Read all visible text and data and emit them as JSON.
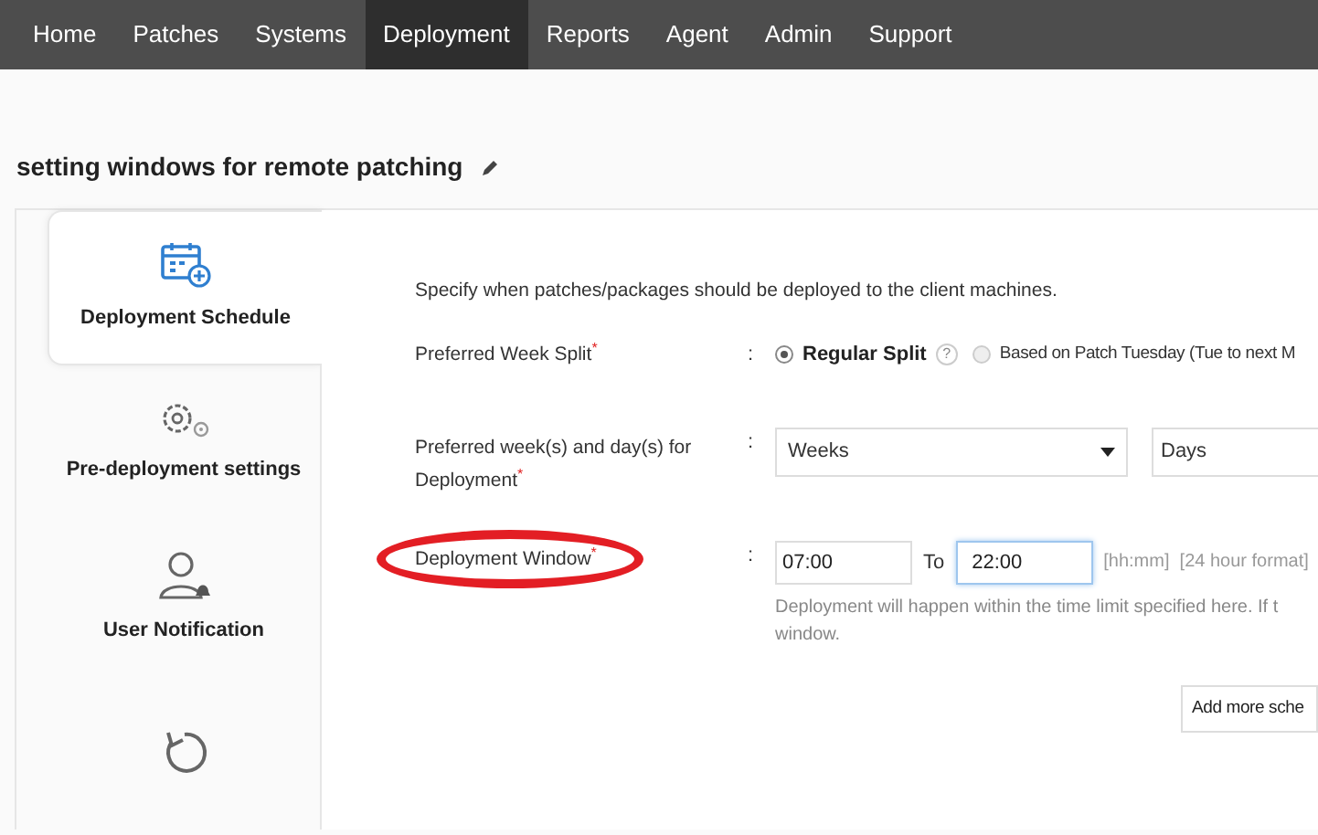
{
  "nav": [
    {
      "label": "Home",
      "selected": false
    },
    {
      "label": "Patches",
      "selected": false
    },
    {
      "label": "Systems",
      "selected": false
    },
    {
      "label": "Deployment",
      "selected": true
    },
    {
      "label": "Reports",
      "selected": false
    },
    {
      "label": "Agent",
      "selected": false
    },
    {
      "label": "Admin",
      "selected": false
    },
    {
      "label": "Support",
      "selected": false
    }
  ],
  "page_title": "setting windows for remote patching",
  "sidebar": [
    {
      "label": "Deployment Schedule",
      "kind": "calendar",
      "selected": true
    },
    {
      "label": "Pre-deployment settings",
      "kind": "gears",
      "selected": false
    },
    {
      "label": "User Notification",
      "kind": "user",
      "selected": false
    },
    {
      "kind": "reload",
      "selected": false
    }
  ],
  "description": "Specify when patches/packages should be deployed to the client machines.",
  "week_split": {
    "label": "Preferred Week Split$^{*}$",
    "colon": ":",
    "options": [
      {
        "label": "Regular Split",
        "selected": true,
        "help": "?"
      },
      {
        "label": "Based on Patch Tuesday (Tue to next M",
        "selected": false
      }
    ]
  },
  "week_days": {
    "label": "Preferred week(s) and day(s) for Deployment$^{*}$",
    "colon": ":",
    "weeks": "Weeks",
    "days": "Days"
  },
  "window": {
    "label": "Deployment Window$^{*}$",
    "colon": ":",
    "highlighted": true,
    "from": "07:00",
    "to_label": "To",
    "to": "22:00",
    "hint": "[hh:mm]  [24 hour format]",
    "help": "Deployment will happen within the time limit specified here. If t",
    "help_2": "window."
  },
  "add_button": "Add more sche"
}
